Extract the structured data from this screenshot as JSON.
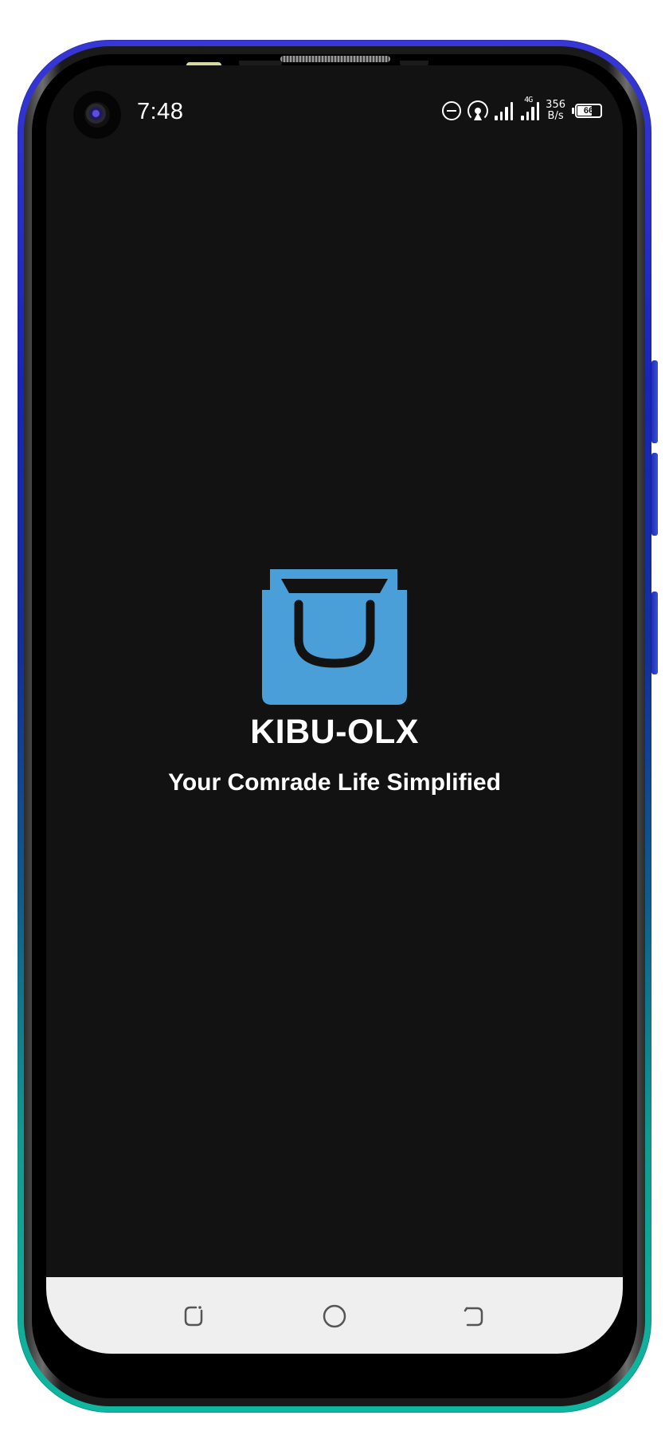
{
  "status_bar": {
    "time": "7:48",
    "network_type": "4G",
    "speed_value": "356",
    "speed_unit": "B/s",
    "battery_level": "66",
    "battery_fraction": 0.66,
    "icons": [
      "do-not-disturb-icon",
      "hotspot-icon",
      "signal-icon",
      "signal-icon",
      "battery-icon"
    ]
  },
  "splash": {
    "app_name": "KIBU-OLX",
    "tagline": "Your Comrade Life Simplified",
    "logo_icon": "shopping-bag-icon",
    "logo_color": "#4a9fd8"
  },
  "nav_bar": {
    "buttons": [
      "recent-apps-icon",
      "home-icon",
      "back-icon"
    ]
  },
  "colors": {
    "screen_background": "#121212",
    "nav_background": "#efefef",
    "text": "#ffffff",
    "accent": "#4a9fd8"
  }
}
